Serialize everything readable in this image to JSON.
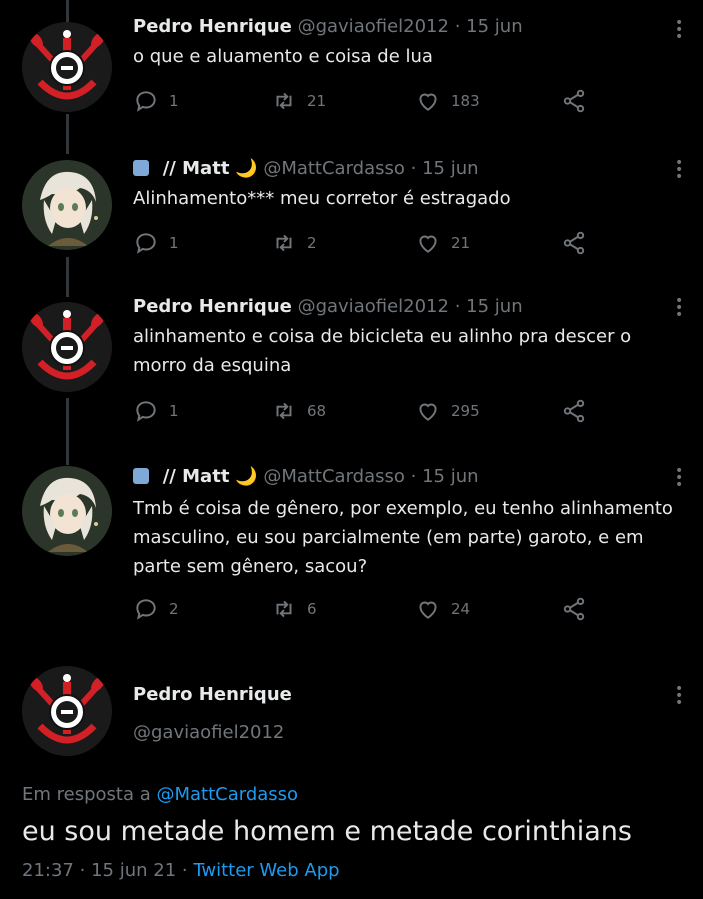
{
  "tweets": [
    {
      "author": "Pedro Henrique",
      "handle": "@gaviaofiel2012",
      "sep": "·",
      "date": "15 jun",
      "text": "o que e aluamento e coisa de lua",
      "replies": "1",
      "retweets": "21",
      "likes": "183",
      "avatar": "corinthians-logo"
    },
    {
      "author": "// Matt",
      "emoji": "🌙",
      "handle": "@MattCardasso",
      "sep": "·",
      "date": "15 jun",
      "text": "Alinhamento*** meu corretor é estragado",
      "replies": "1",
      "retweets": "2",
      "likes": "21",
      "avatar": "anime-character"
    },
    {
      "author": "Pedro Henrique",
      "handle": "@gaviaofiel2012",
      "sep": "·",
      "date": "15 jun",
      "text": "alinhamento e coisa de bicicleta eu alinho pra descer o morro da esquina",
      "replies": "1",
      "retweets": "68",
      "likes": "295",
      "avatar": "corinthians-logo"
    },
    {
      "author": "// Matt",
      "emoji": "🌙",
      "handle": "@MattCardasso",
      "sep": "·",
      "date": "15 jun",
      "text": "Tmb é coisa de gênero, por exemplo, eu tenho alinhamento masculino, eu sou parcialmente (em parte) garoto, e em parte sem gênero, sacou?",
      "replies": "2",
      "retweets": "6",
      "likes": "24",
      "avatar": "anime-character"
    }
  ],
  "focused": {
    "author": "Pedro Henrique",
    "handle": "@gaviaofiel2012",
    "reply_prefix": "Em resposta a",
    "reply_to": "@MattCardasso",
    "text": "eu sou metade homem e metade corinthians",
    "time": "21:37",
    "sep1": "·",
    "date": "15 jun 21",
    "sep2": "·",
    "source": "Twitter Web App",
    "avatar": "corinthians-logo"
  },
  "colors": {
    "background": "#000000",
    "text": "#e7e9ea",
    "muted": "#71767b",
    "link": "#1d9bf0",
    "corinthians_red": "#d32027"
  },
  "icons": [
    "reply-icon",
    "retweet-icon",
    "like-icon",
    "share-icon",
    "more-icon"
  ]
}
